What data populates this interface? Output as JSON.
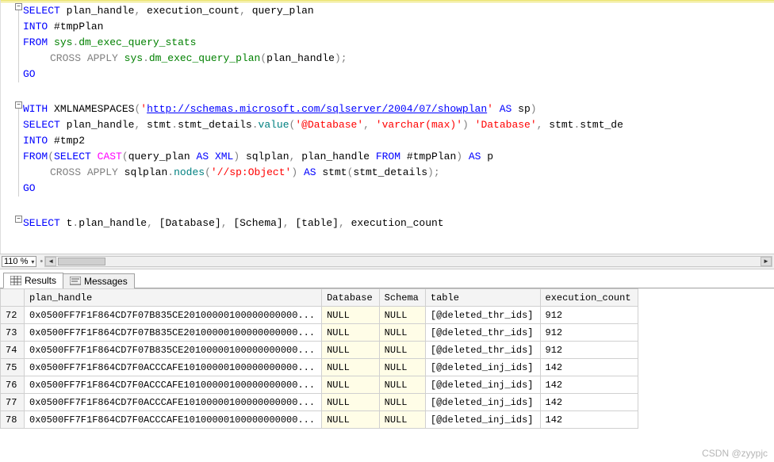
{
  "editor": {
    "fold_minus": "−",
    "l1_select": "SELECT",
    "l1_cols": " plan_handle",
    "l1_cols2": " execution_count",
    "l1_cols3": " query_plan",
    "l2_into": "INTO",
    "l2_tmp": " #tmpPlan",
    "l3_from": "FROM",
    "l3_sys": " sys",
    "l3_dot": ".",
    "l3_dmv": "dm_exec_query_stats",
    "l4_cross": "CROSS",
    "l4_apply": "APPLY",
    "l4_sys": " sys",
    "l4_plan": "dm_exec_query_plan",
    "l4_lp": "(",
    "l4_arg": "plan_handle",
    "l4_rp": ")",
    "l4_semi": ";",
    "l5_go": "GO",
    "l7_with": "WITH",
    "l7_xn": " XMLNAMESPACES",
    "l7_p1": "(",
    "l7_q1": "'",
    "l7_url": "http://schemas.microsoft.com/sqlserver/2004/07/showplan",
    "l7_q2": "'",
    "l7_as": " AS",
    "l7_sp": " sp",
    "l7_p2": ")",
    "l8_select": "SELECT",
    "l8_rest1": " plan_handle",
    "l8_stmt": " stmt",
    "l8_dot1": ".",
    "l8_sd": "stmt_details",
    "l8_dot2": ".",
    "l8_val": "value",
    "l8_p1": "(",
    "l8_s1": "'@Database'",
    "l8_s2": "'varchar(max)'",
    "l8_p2": ")",
    "l8_s3": "'Database'",
    "l8_tail": " stmt",
    "l8_dot3": ".",
    "l8_sd2": "stmt_de",
    "l9_into": "INTO",
    "l9_tmp": " #tmp2",
    "l10_from": "FROM",
    "l10_p1": "(",
    "l10_select": "SELECT",
    "l10_cast": "CAST",
    "l10_p2": "(",
    "l10_qp": "query_plan ",
    "l10_as": "AS",
    "l10_xml": "XML",
    "l10_p3": ")",
    "l10_sqlplan": " sqlplan",
    "l10_ph": " plan_handle ",
    "l10_from2": "FROM",
    "l10_tmp": " #tmpPlan",
    "l10_p4": ")",
    "l10_as2": "AS",
    "l10_p": " p",
    "l11_cross": "CROSS",
    "l11_apply": "APPLY",
    "l11_sql": " sqlplan",
    "l11_dot": ".",
    "l11_nodes": "nodes",
    "l11_p1": "(",
    "l11_str": "'//sp:Object'",
    "l11_p2": ")",
    "l11_as": "AS",
    "l11_stmt": " stmt",
    "l11_p3": "(",
    "l11_sd": "stmt_details",
    "l11_p4": ")",
    "l11_semi": ";",
    "l12_go": "GO",
    "l14_select": "SELECT",
    "l14_t": " t",
    "l14_dot": ".",
    "l14_ph": "plan_handle",
    "l14_db": " [Database]",
    "l14_sc": " [Schema]",
    "l14_tb": " [table]",
    "l14_ec": " execution_count"
  },
  "zoom": {
    "value": "110 %"
  },
  "tabs": {
    "results": "Results",
    "messages": "Messages"
  },
  "grid": {
    "headers": {
      "plan_handle": "plan_handle",
      "database": "Database",
      "schema": "Schema",
      "table": "table",
      "execution_count": "execution_count"
    },
    "null": "NULL",
    "rows": [
      {
        "n": "72",
        "ph": "0x0500FF7F1F864CD7F07B835CE20100000100000000000...",
        "db": "NULL",
        "sc": "NULL",
        "tb": "[@deleted_thr_ids]",
        "ec": "912"
      },
      {
        "n": "73",
        "ph": "0x0500FF7F1F864CD7F07B835CE20100000100000000000...",
        "db": "NULL",
        "sc": "NULL",
        "tb": "[@deleted_thr_ids]",
        "ec": "912"
      },
      {
        "n": "74",
        "ph": "0x0500FF7F1F864CD7F07B835CE20100000100000000000...",
        "db": "NULL",
        "sc": "NULL",
        "tb": "[@deleted_thr_ids]",
        "ec": "912"
      },
      {
        "n": "75",
        "ph": "0x0500FF7F1F864CD7F0ACCCAFE10100000100000000000...",
        "db": "NULL",
        "sc": "NULL",
        "tb": "[@deleted_inj_ids]",
        "ec": "142"
      },
      {
        "n": "76",
        "ph": "0x0500FF7F1F864CD7F0ACCCAFE10100000100000000000...",
        "db": "NULL",
        "sc": "NULL",
        "tb": "[@deleted_inj_ids]",
        "ec": "142"
      },
      {
        "n": "77",
        "ph": "0x0500FF7F1F864CD7F0ACCCAFE10100000100000000000...",
        "db": "NULL",
        "sc": "NULL",
        "tb": "[@deleted_inj_ids]",
        "ec": "142"
      },
      {
        "n": "78",
        "ph": "0x0500FF7F1F864CD7F0ACCCAFE10100000100000000000...",
        "db": "NULL",
        "sc": "NULL",
        "tb": "[@deleted_inj_ids]",
        "ec": "142"
      }
    ]
  },
  "watermark": "CSDN @zyypjc"
}
